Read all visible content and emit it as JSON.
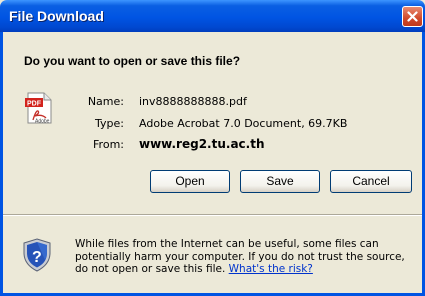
{
  "window": {
    "title": "File Download"
  },
  "question": "Do you want to open or save this file?",
  "file": {
    "icon": "pdf-file-icon",
    "name_label": "Name:",
    "name_value": "inv8888888888.pdf",
    "type_label": "Type:",
    "type_value": "Adobe Acrobat 7.0 Document, 69.7KB",
    "from_label": "From:",
    "from_value": "www.reg2.tu.ac.th"
  },
  "buttons": {
    "open_label": "Open",
    "save_label": "Save",
    "cancel_label": "Cancel"
  },
  "warning": {
    "icon": "shield-question-icon",
    "text": "While files from the Internet can be useful, some files can potentially harm your computer. If you do not trust the source, do not open or save this file.",
    "link": "What's the risk?"
  },
  "colors": {
    "titlebar": "#0054e3",
    "close": "#d1492b",
    "background": "#ece9d8",
    "link": "#0033cc"
  }
}
